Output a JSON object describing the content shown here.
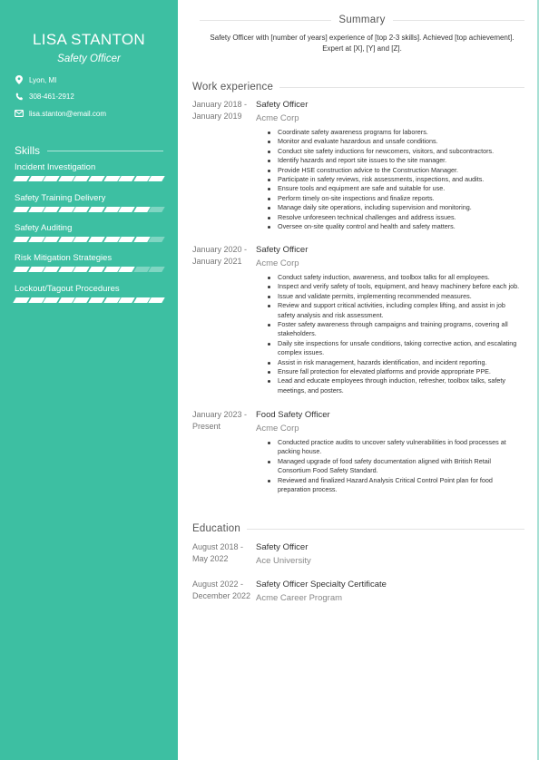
{
  "profile": {
    "name": "LISA STANTON",
    "role": "Safety Officer",
    "location": "Lyon, MI",
    "phone": "308-461-2912",
    "email": "lisa.stanton@email.com"
  },
  "icons": {
    "location": "map-pin-icon",
    "phone": "phone-icon",
    "email": "envelope-icon"
  },
  "colors": {
    "accent": "#3dbfa2",
    "border": "#a8e0d4"
  },
  "skills": {
    "heading": "Skills",
    "segments_total": 10,
    "items": [
      {
        "label": "Incident Investigation",
        "level": 10
      },
      {
        "label": "Safety Training Delivery",
        "level": 9
      },
      {
        "label": "Safety Auditing",
        "level": 9
      },
      {
        "label": "Risk Mitigation Strategies",
        "level": 8
      },
      {
        "label": "Lockout/Tagout Procedures",
        "level": 10
      }
    ]
  },
  "summary": {
    "heading": "Summary",
    "text": "Safety Officer with [number of years] experience of [top 2-3 skills]. Achieved [top achievement]. Expert at [X], [Y] and [Z]."
  },
  "work": {
    "heading": "Work experience",
    "jobs": [
      {
        "date_start": "January 2018 -",
        "date_end": "January 2019",
        "title": "Safety Officer",
        "company": "Acme Corp",
        "bullets": [
          "Coordinate safety awareness programs for laborers.",
          "Monitor and evaluate hazardous and unsafe conditions.",
          "Conduct site safety inductions for newcomers, visitors, and subcontractors.",
          "Identify hazards and report site issues to the site manager.",
          "Provide HSE construction advice to the Construction Manager.",
          "Participate in safety reviews, risk assessments, inspections, and audits.",
          "Ensure tools and equipment are safe and suitable for use.",
          "Perform timely on-site inspections and finalize reports.",
          "Manage daily site operations, including supervision and monitoring.",
          "Resolve unforeseen technical challenges and address issues.",
          "Oversee on-site quality control and health and safety matters."
        ]
      },
      {
        "date_start": "January 2020 -",
        "date_end": "January 2021",
        "title": "Safety Officer",
        "company": "Acme Corp",
        "bullets": [
          "Conduct safety induction, awareness, and toolbox talks for all employees.",
          "Inspect and verify safety of tools, equipment, and heavy machinery before each job.",
          "Issue and validate permits, implementing recommended measures.",
          "Review and support critical activities, including complex lifting, and assist in job safety analysis and risk assessment.",
          "Foster safety awareness through campaigns and training programs, covering all stakeholders.",
          "Daily site inspections for unsafe conditions, taking corrective action, and escalating complex issues.",
          "Assist in risk management, hazards identification, and incident reporting.",
          "Ensure fall protection for elevated platforms and provide appropriate PPE.",
          "Lead and educate employees through induction, refresher, toolbox talks, safety meetings, and posters."
        ]
      },
      {
        "date_start": "January 2023 -",
        "date_end": "Present",
        "title": "Food Safety Officer",
        "company": "Acme Corp",
        "bullets": [
          "Conducted practice audits to uncover safety vulnerabilities in food processes at packing house.",
          "Managed upgrade of food safety documentation aligned with British Retail Consortium Food Safety Standard.",
          "Reviewed and finalized Hazard Analysis Critical Control Point plan for food preparation process."
        ]
      }
    ]
  },
  "education": {
    "heading": "Education",
    "items": [
      {
        "date_start": "August 2018 -",
        "date_end": "May 2022",
        "title": "Safety Officer",
        "school": "Ace University"
      },
      {
        "date_start": "August 2022 -",
        "date_end": "December 2022",
        "title": "Safety Officer Specialty Certificate",
        "school": "Acme Career Program"
      }
    ]
  }
}
